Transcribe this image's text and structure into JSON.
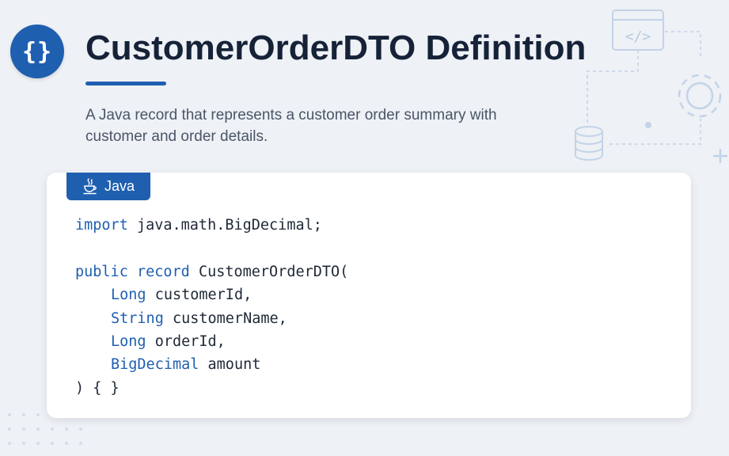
{
  "header": {
    "logo_glyph": "{}",
    "title": "CustomerOrderDTO Definition",
    "subtitle": "A Java record that represents a customer order summary with customer and order details.",
    "accent_color": "#1f5fb0"
  },
  "code_block": {
    "language": "Java",
    "language_icon": "java-coffee-cup-icon",
    "lines": {
      "import_kw": "import",
      "import_path": "java.math.BigDecimal;",
      "decl_public": "public",
      "decl_record": "record",
      "decl_name": "CustomerOrderDTO(",
      "f1_type": "Long",
      "f1_name": "customerId,",
      "f2_type": "String",
      "f2_name": "customerName,",
      "f3_type": "Long",
      "f3_name": "orderId,",
      "f4_type": "BigDecimal",
      "f4_name": "amount",
      "close": ") { }"
    }
  },
  "decorations": {
    "code_window_icon_text": "</>",
    "icons": [
      "code-window-icon",
      "gear-icon",
      "database-icon",
      "plus-icon"
    ]
  }
}
